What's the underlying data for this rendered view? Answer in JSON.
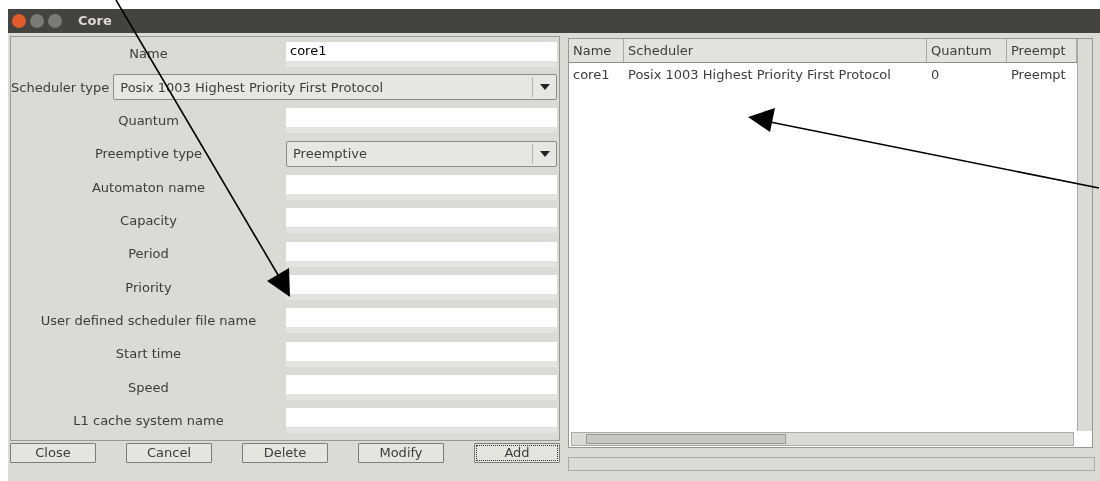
{
  "window": {
    "title": "Core"
  },
  "form": {
    "fields": [
      {
        "label": "Name",
        "kind": "text",
        "value": "core1"
      },
      {
        "label": "Scheduler type",
        "kind": "wide-select",
        "value": "Posix 1003 Highest Priority First Protocol"
      },
      {
        "label": "Quantum",
        "kind": "text"
      },
      {
        "label": "Preemptive type",
        "kind": "select",
        "value": "Preemptive"
      },
      {
        "label": "Automaton name",
        "kind": "text"
      },
      {
        "label": "Capacity",
        "kind": "text"
      },
      {
        "label": "Period",
        "kind": "text"
      },
      {
        "label": "Priority",
        "kind": "text"
      },
      {
        "label": "User defined scheduler file name",
        "kind": "text"
      },
      {
        "label": "Start time",
        "kind": "text"
      },
      {
        "label": "Speed",
        "kind": "text"
      },
      {
        "label": "L1 cache system name",
        "kind": "text"
      }
    ]
  },
  "buttons": [
    {
      "label": "Close",
      "focused": false
    },
    {
      "label": "Cancel",
      "focused": false
    },
    {
      "label": "Delete",
      "focused": false
    },
    {
      "label": "Modify",
      "focused": false
    },
    {
      "label": "Add",
      "focused": true
    }
  ],
  "table": {
    "columns": [
      "Name",
      "Scheduler",
      "Quantum",
      "Preempt"
    ],
    "rows": [
      [
        "core1",
        "Posix 1003 Highest Priority First Protocol",
        "0",
        "Preempt"
      ]
    ]
  }
}
